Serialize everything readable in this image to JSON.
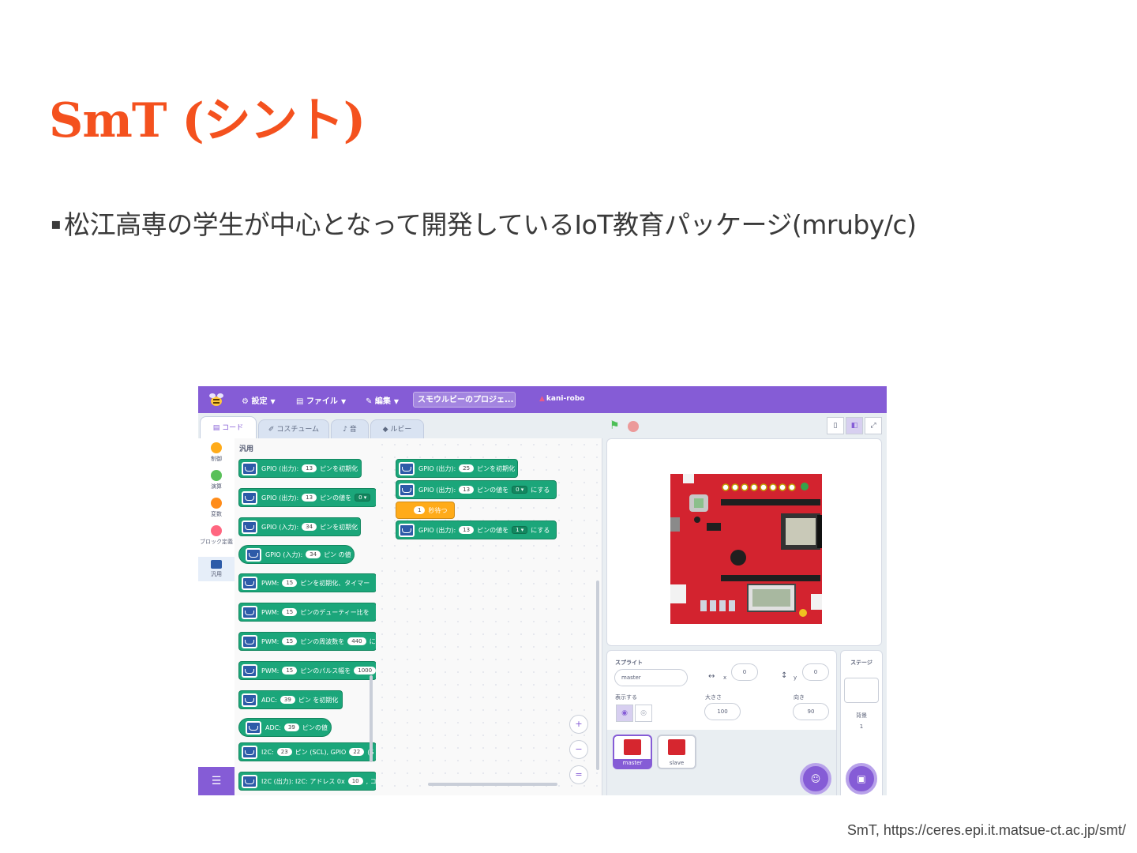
{
  "slide": {
    "title": "SmT (シント)",
    "bullet": "松江高専の学生が中心となって開発しているIoT教育パッケージ(mruby/c)",
    "source": "SmT, https://ceres.epi.it.matsue-ct.ac.jp/smt/"
  },
  "colors": {
    "title": "#f4511e",
    "menubar": "#855cd6",
    "block_green": "#1ba67a",
    "block_orange": "#ffab19"
  },
  "app": {
    "menu": {
      "settings": "設定",
      "file": "ファイル",
      "edit": "編集",
      "project_name": "スモウルビーのプロジェ...",
      "user": "kani-robo"
    },
    "tabs": {
      "code": "コード",
      "costume": "コスチューム",
      "sound": "音",
      "ruby": "ルビー"
    },
    "categories": [
      {
        "label": "制御",
        "color": "#ffab19"
      },
      {
        "label": "演算",
        "color": "#59c059"
      },
      {
        "label": "変数",
        "color": "#ff8c1a"
      },
      {
        "label": "ブロック定義",
        "color": "#ff6680"
      },
      {
        "label": "汎用",
        "color": "#2d5ba8"
      }
    ],
    "palette": {
      "heading": "汎用",
      "blocks": [
        {
          "t1": "GPIO (出力):",
          "v1": "13",
          "t2": "ピンを初期化"
        },
        {
          "t1": "GPIO (出力):",
          "v1": "13",
          "t2": "ピンの値を",
          "dd": "0 ▾"
        },
        {
          "t1": "GPIO (入力):",
          "v1": "34",
          "t2": "ピンを初期化"
        },
        {
          "t1": "GPIO (入力):",
          "v1": "34",
          "t2": "ピン の値"
        },
        {
          "t1": "PWM:",
          "v1": "15",
          "t2": "ピンを初期化、タイマー"
        },
        {
          "t1": "PWM:",
          "v1": "15",
          "t2": "ピンのデューティー比を"
        },
        {
          "t1": "PWM:",
          "v1": "15",
          "t2": "ピンの周波数を",
          "v2": "440",
          "t3": "に"
        },
        {
          "t1": "PWM:",
          "v1": "15",
          "t2": "ピンのパルス幅を",
          "v2": "1000"
        },
        {
          "t1": "ADC:",
          "v1": "39",
          "t2": "ピン を初期化"
        },
        {
          "t1": "ADC:",
          "v1": "39",
          "t2": "ピンの値"
        },
        {
          "t1": "I2C:",
          "v1": "23",
          "t2": "ピン (SCL), GPIO",
          "v2": "22",
          "t3": "(S"
        },
        {
          "t1": "I2C (出力): I2C: アドレス 0x",
          "v1": "10",
          "t2": ", コマ"
        }
      ]
    },
    "script": [
      {
        "t1": "GPIO (出力):",
        "v1": "25",
        "t2": "ピンを初期化"
      },
      {
        "t1": "GPIO (出力):",
        "v1": "13",
        "t2": "ピンの値を",
        "dd": "0 ▾",
        "t3": "にする"
      },
      {
        "v1": "1",
        "t2": "秒待つ"
      },
      {
        "t1": "GPIO (出力):",
        "v1": "13",
        "t2": "ピンの値を",
        "dd": "1 ▾",
        "t3": "にする"
      }
    ],
    "zoom": {
      "in": "+",
      "out": "−",
      "reset": "="
    },
    "sprite_info": {
      "sprite_label": "スプライト",
      "name": "master",
      "x_label": "x",
      "x": "0",
      "y_label": "y",
      "y": "0",
      "show_label": "表示する",
      "size_label": "大きさ",
      "size": "100",
      "direction_label": "向き",
      "direction": "90"
    },
    "sprites": [
      {
        "name": "master"
      },
      {
        "name": "slave"
      }
    ],
    "stage_pane": {
      "label": "ステージ",
      "backdrop_label": "背景",
      "backdrop_count": "1"
    },
    "icons": {
      "settings": "gear-icon",
      "file": "file-icon",
      "edit": "pencil-icon",
      "flag": "green-flag-icon",
      "stop": "stop-icon"
    }
  }
}
